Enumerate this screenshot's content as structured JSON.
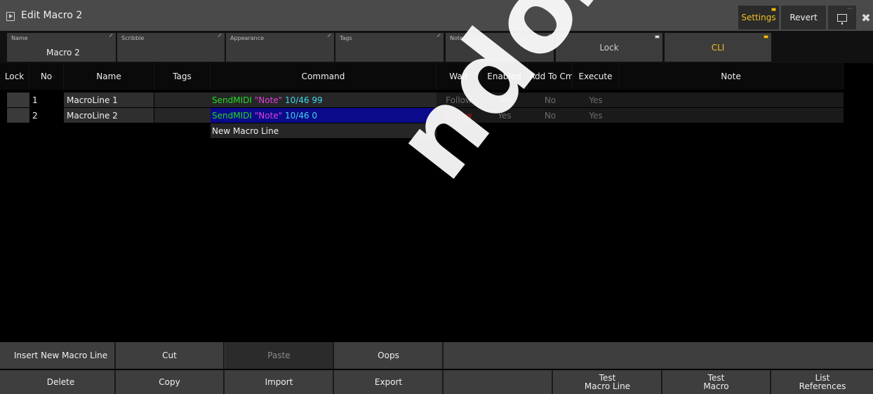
{
  "window": {
    "title": "Edit Macro 2"
  },
  "toolbar": {
    "settings_label": "Settings",
    "revert_label": "Revert",
    "close_glyph": "✖",
    "display_icon": "monitor-icon"
  },
  "fields": {
    "name": {
      "label": "Name",
      "value": "Macro 2"
    },
    "scribble": {
      "label": "Scribble",
      "value": ""
    },
    "appearance": {
      "label": "Appearance",
      "value": ""
    },
    "tags": {
      "label": "Tags",
      "value": ""
    },
    "note": {
      "label": "Note",
      "value": ""
    },
    "lock_button": "Lock",
    "cli_button": "CLI"
  },
  "table": {
    "columns": {
      "lock": "Lock",
      "no": "No",
      "name": "Name",
      "tags": "Tags",
      "command": "Command",
      "wait": "Wait",
      "enabled": "Enabled",
      "add_to_cmd": "Add To Cmd",
      "execute": "Execute",
      "note": "Note"
    },
    "rows": [
      {
        "no": "1",
        "name": "MacroLine 1",
        "cmd_keyword": "SendMIDI",
        "cmd_string": "\"Note\"",
        "cmd_args": "10/46 99",
        "wait": "Follow",
        "enabled": "Yes",
        "add_to_cmd": "No",
        "execute": "Yes",
        "selected": false
      },
      {
        "no": "2",
        "name": "MacroLine 2",
        "cmd_keyword": "SendMIDI",
        "cmd_string": "\"Note\"",
        "cmd_args": "10/46 0",
        "wait": "Follow",
        "enabled": "Yes",
        "add_to_cmd": "No",
        "execute": "Yes",
        "selected": true
      }
    ],
    "new_line_label": "New Macro Line"
  },
  "bottom": {
    "row1": {
      "insert": "Insert New Macro Line",
      "cut": "Cut",
      "paste": "Paste",
      "oops": "Oops"
    },
    "row2": {
      "delete": "Delete",
      "copy": "Copy",
      "import": "Import",
      "export": "Export",
      "test_line": "Test\nMacro Line",
      "test_macro": "Test\nMacro",
      "list_refs": "List\nReferences"
    }
  },
  "watermark": "ndoza.com",
  "colors": {
    "accent_yellow": "#f0c020",
    "selected_row": "#0a0a8a",
    "follow_red": "#b01818",
    "cmd_green": "#22dd22",
    "cmd_magenta": "#e040e0",
    "cmd_cyan": "#40d8f0"
  }
}
